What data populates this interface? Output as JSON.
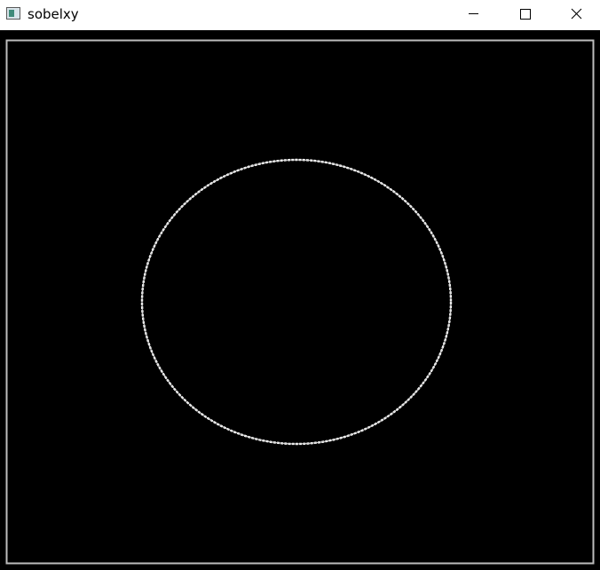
{
  "window": {
    "title": "sobelxy",
    "icon": "opencv-window-icon"
  },
  "controls": {
    "minimize": "minimize-icon",
    "maximize": "maximize-icon",
    "close": "close-icon"
  },
  "image": {
    "background_color": "#000000",
    "edge_color": "#ffffff",
    "border_color": "#bdbdbd"
  }
}
